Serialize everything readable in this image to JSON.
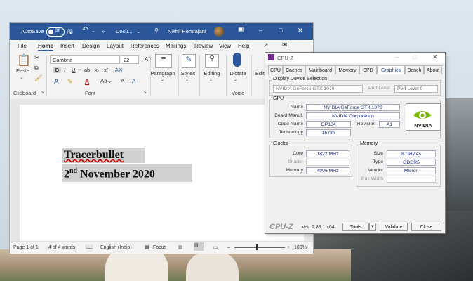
{
  "word": {
    "autosave_label": "AutoSave",
    "autosave_state": "Off",
    "doc_name": "Docu...",
    "user_name": "Nikhil Hemrajani",
    "menu": [
      "File",
      "Home",
      "Insert",
      "Design",
      "Layout",
      "References",
      "Mailings",
      "Review",
      "View",
      "Help"
    ],
    "ribbon": {
      "paste": "Paste",
      "font_name": "Cambria",
      "font_size": "22",
      "paragraph": "Paragraph",
      "styles": "Styles",
      "editing": "Editing",
      "dictate": "Dictate",
      "edit": "Edit",
      "group_clipboard": "Clipboard",
      "group_font": "Font",
      "group_voice": "Voice"
    },
    "document": {
      "line1": "Tracerbullet",
      "line2_day": "2",
      "line2_sup": "nd",
      "line2_rest": " November 2020"
    },
    "status": {
      "page": "Page 1 of 1",
      "words": "4 of 4 words",
      "language": "English (India)",
      "focus": "Focus",
      "zoom": "100%"
    }
  },
  "cpuz": {
    "title": "CPU-Z",
    "tabs": [
      "CPU",
      "Caches",
      "Mainboard",
      "Memory",
      "SPD",
      "Graphics",
      "Bench",
      "About"
    ],
    "active_tab": "Graphics",
    "display_selection_label": "Display Device Selection",
    "device": "NVIDIA GeForce GTX 1070",
    "perf_level_label": "Perf Level",
    "perf_level": "Perf Level 0",
    "gpu": {
      "label": "GPU",
      "name_label": "Name",
      "name": "NVIDIA GeForce GTX 1070",
      "manuf_label": "Board Manuf.",
      "manuf": "NVIDIA Corporation",
      "code_label": "Code Name",
      "code": "GP104",
      "revision_label": "Revision",
      "revision": "A1",
      "tech_label": "Technology",
      "tech": "16 nm",
      "logo": "NVIDIA"
    },
    "clocks": {
      "label": "Clocks",
      "core_label": "Core",
      "core": "1822 MHz",
      "shader_label": "Shader",
      "memory_label": "Memory",
      "memory": "4006 MHz"
    },
    "memory": {
      "label": "Memory",
      "size_label": "Size",
      "size": "8 GBytes",
      "type_label": "Type",
      "type": "GDDR5",
      "vendor_label": "Vendor",
      "vendor": "Micron",
      "bus_label": "Bus Width"
    },
    "footer": {
      "brand": "CPU-Z",
      "version": "Ver. 1.89.1.x64",
      "tools": "Tools",
      "validate": "Validate",
      "close": "Close"
    }
  }
}
